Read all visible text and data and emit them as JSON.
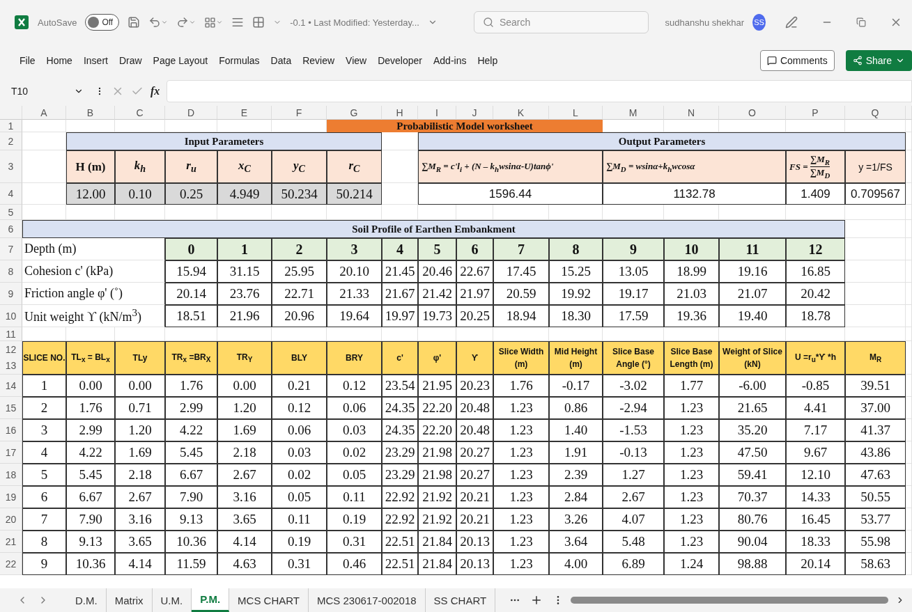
{
  "title_bar": {
    "autosave_label": "AutoSave",
    "autosave_state": "Off",
    "autosave_on": false,
    "file_title": "-0.1 • Last Modified: Yesterday...",
    "search_placeholder": "Search",
    "user_name": "sudhanshu shekhar",
    "user_initials": "SS"
  },
  "menu": [
    "File",
    "Home",
    "Insert",
    "Draw",
    "Page Layout",
    "Formulas",
    "Data",
    "Review",
    "View",
    "Developer",
    "Add-ins",
    "Help"
  ],
  "comments_label": "Comments",
  "share_label": "Share",
  "formula_bar": {
    "name_box": "T10",
    "fx": "fx"
  },
  "sheet": {
    "columns": [
      "A",
      "B",
      "C",
      "D",
      "E",
      "F",
      "G",
      "H",
      "I",
      "J",
      "K",
      "L",
      "M",
      "N",
      "O",
      "P",
      "Q"
    ],
    "row_numbers": [
      "1",
      "2",
      "3",
      "4",
      "5",
      "6",
      "7",
      "8",
      "9",
      "10",
      "11",
      "12",
      "13",
      "14",
      "15",
      "16",
      "17",
      "18",
      "19",
      "20",
      "21",
      "22"
    ],
    "title": "Probabilistic Model worksheet",
    "input_parameters": {
      "title": "Input Parameters",
      "headers": [
        {
          "text": "H (m)",
          "math": false
        },
        {
          "text": "k$_{h}$",
          "math": true
        },
        {
          "text": "r$_{u}$",
          "math": true
        },
        {
          "text": "x$_{C}$",
          "math": true
        },
        {
          "text": "y$_{C}$",
          "math": true
        },
        {
          "text": "r$_{C}$",
          "math": true
        }
      ],
      "values": [
        "12.00",
        "0.10",
        "0.25",
        "4.949",
        "50.234",
        "50.214"
      ]
    },
    "output_parameters": {
      "title": "Output Parameters",
      "headers": [
        {
          "kind": "formula",
          "text": "∑M$_{R}$ = c'l$_{i}$ + (N – k$_{h}$wsinα-U)tanϕ'"
        },
        {
          "kind": "formula",
          "text": "∑M$_{D}$ = wsinα+k$_{h}$wcosα"
        },
        {
          "kind": "fraction",
          "lhs": "FS =",
          "numerator": "∑M$_{R}$",
          "denominator": "∑M$_{D}$"
        },
        {
          "kind": "plain",
          "text": "y =1/FS"
        }
      ],
      "values": [
        "1596.44",
        "1132.78",
        "1.409",
        "0.709567"
      ]
    },
    "soil_profile": {
      "title": "Soil Profile of Earthen Embankment",
      "depth_label": "Depth (m)",
      "depths": [
        "0",
        "1",
        "2",
        "3",
        "4",
        "5",
        "6",
        "7",
        "8",
        "9",
        "10",
        "11",
        "12"
      ],
      "properties": [
        {
          "label": "Cohesion c' (kPa)",
          "values": [
            "15.94",
            "31.15",
            "25.95",
            "20.10",
            "21.45",
            "20.46",
            "22.67",
            "17.45",
            "15.25",
            "13.05",
            "18.99",
            "19.16",
            "16.85"
          ]
        },
        {
          "label": "Friction angle φ' (˚)",
          "values": [
            "20.14",
            "23.76",
            "22.71",
            "21.33",
            "21.67",
            "21.42",
            "21.97",
            "20.59",
            "19.92",
            "19.17",
            "21.03",
            "21.07",
            "20.42"
          ]
        },
        {
          "label": "Unit weight ϒ (kN/m$^{3}$)",
          "values": [
            "18.51",
            "21.96",
            "20.96",
            "19.64",
            "19.97",
            "19.73",
            "20.25",
            "18.94",
            "18.30",
            "17.59",
            "19.36",
            "19.40",
            "18.78"
          ]
        }
      ]
    },
    "slices": {
      "headers": [
        "SLICE NO.",
        "TL$_{x}$ = BL$_{x}$",
        "TLy",
        "TR$_{x}$ =BR$_{X}$",
        "TR$_{Y}$",
        "BLY",
        "BRY",
        "c'",
        "φ'",
        "ϒ",
        "Slice Width (m)",
        "Mid Height (m)",
        "Slice Base Angle (°)",
        "Slice Base Length (m)",
        "Weight of Slice (kN)",
        "U =r$_{u}$*ϒ *h",
        "M$_{R}$"
      ],
      "rows": [
        [
          "1",
          "0.00",
          "0.00",
          "1.76",
          "0.00",
          "0.21",
          "0.12",
          "23.54",
          "21.95",
          "20.23",
          "1.76",
          "-0.17",
          "-3.02",
          "1.77",
          "-6.00",
          "-0.85",
          "39.51"
        ],
        [
          "2",
          "1.76",
          "0.71",
          "2.99",
          "1.20",
          "0.12",
          "0.06",
          "24.35",
          "22.20",
          "20.48",
          "1.23",
          "0.86",
          "-2.94",
          "1.23",
          "21.65",
          "4.41",
          "37.00"
        ],
        [
          "3",
          "2.99",
          "1.20",
          "4.22",
          "1.69",
          "0.06",
          "0.03",
          "24.35",
          "22.20",
          "20.48",
          "1.23",
          "1.40",
          "-1.53",
          "1.23",
          "35.20",
          "7.17",
          "41.37"
        ],
        [
          "4",
          "4.22",
          "1.69",
          "5.45",
          "2.18",
          "0.03",
          "0.02",
          "23.29",
          "21.98",
          "20.27",
          "1.23",
          "1.91",
          "-0.13",
          "1.23",
          "47.50",
          "9.67",
          "43.86"
        ],
        [
          "5",
          "5.45",
          "2.18",
          "6.67",
          "2.67",
          "0.02",
          "0.05",
          "23.29",
          "21.98",
          "20.27",
          "1.23",
          "2.39",
          "1.27",
          "1.23",
          "59.41",
          "12.10",
          "47.63"
        ],
        [
          "6",
          "6.67",
          "2.67",
          "7.90",
          "3.16",
          "0.05",
          "0.11",
          "22.92",
          "21.92",
          "20.21",
          "1.23",
          "2.84",
          "2.67",
          "1.23",
          "70.37",
          "14.33",
          "50.55"
        ],
        [
          "7",
          "7.90",
          "3.16",
          "9.13",
          "3.65",
          "0.11",
          "0.19",
          "22.92",
          "21.92",
          "20.21",
          "1.23",
          "3.26",
          "4.07",
          "1.23",
          "80.76",
          "16.45",
          "53.77"
        ],
        [
          "8",
          "9.13",
          "3.65",
          "10.36",
          "4.14",
          "0.19",
          "0.31",
          "22.51",
          "21.84",
          "20.13",
          "1.23",
          "3.64",
          "5.48",
          "1.23",
          "90.04",
          "18.33",
          "55.98"
        ],
        [
          "9",
          "10.36",
          "4.14",
          "11.59",
          "4.63",
          "0.31",
          "0.46",
          "22.51",
          "21.84",
          "20.13",
          "1.23",
          "4.00",
          "6.89",
          "1.24",
          "98.88",
          "20.14",
          "58.63"
        ]
      ]
    }
  },
  "sheet_tabs": [
    {
      "label": "D.M.",
      "selected": false
    },
    {
      "label": "Matrix",
      "selected": false
    },
    {
      "label": "U.M.",
      "selected": false
    },
    {
      "label": "P.M.",
      "selected": true
    },
    {
      "label": "MCS CHART",
      "selected": false
    },
    {
      "label": "MCS 230617-002018",
      "selected": false
    },
    {
      "label": "SS CHART",
      "selected": false
    }
  ]
}
